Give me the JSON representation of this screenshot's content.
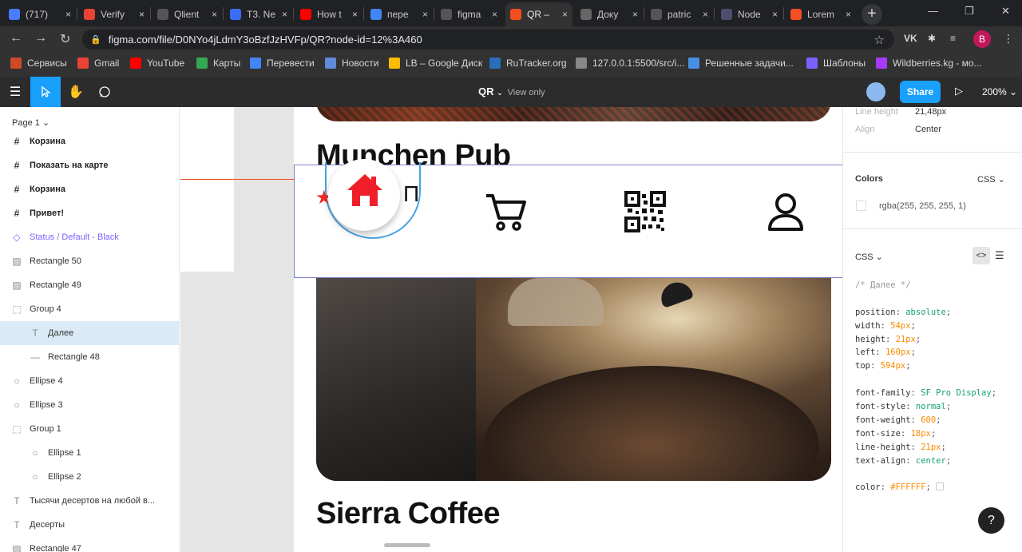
{
  "browser": {
    "tabs": [
      {
        "title": "(717)",
        "icon": "tab-favicon-pause",
        "color": "#4a7cff",
        "active": false
      },
      {
        "title": "Verify",
        "icon": "tab-favicon-gmail",
        "color": "#ea4335",
        "active": false
      },
      {
        "title": "Qlient",
        "icon": "tab-favicon-github",
        "color": "#555555",
        "active": false
      },
      {
        "title": "T3. Ne",
        "icon": "tab-favicon-doc",
        "color": "#3b6ef5",
        "active": false
      },
      {
        "title": "How t",
        "icon": "tab-favicon-youtube",
        "color": "#ff0000",
        "active": false
      },
      {
        "title": "пере",
        "icon": "tab-favicon-google",
        "color": "#4285f4",
        "active": false
      },
      {
        "title": "figma",
        "icon": "tab-favicon-github",
        "color": "#555555",
        "active": false
      },
      {
        "title": "QR –",
        "icon": "tab-favicon-figma",
        "color": "#f24e1e",
        "active": true
      },
      {
        "title": "Доку",
        "icon": "tab-favicon-globe",
        "color": "#666666",
        "active": false
      },
      {
        "title": "patric",
        "icon": "tab-favicon-github",
        "color": "#555555",
        "active": false
      },
      {
        "title": "Node",
        "icon": "tab-favicon-node",
        "color": "#4d4d6d",
        "active": false
      },
      {
        "title": "Lorem",
        "icon": "tab-favicon-ms",
        "color": "#f25022",
        "active": false
      }
    ],
    "tab_close": "×",
    "new_tab": "+",
    "window": {
      "minimize": "—",
      "maximize": "❐",
      "close": "✕"
    },
    "nav": {
      "back": "←",
      "forward": "→",
      "reload": "↻"
    },
    "url": "figma.com/file/D0NYo4jLdmY3oBzfJzHVFp/QR?node-id=12%3A460",
    "lock": "🔒",
    "star": "☆",
    "extensions": [
      "VK",
      "✱",
      "≡",
      "▮"
    ],
    "profile_initial": "В",
    "bookmarks": [
      {
        "label": "Сервисы",
        "icon": "apps-icon",
        "color": "#d04a2a"
      },
      {
        "label": "Gmail",
        "icon": "gmail-icon",
        "color": "#ea4335"
      },
      {
        "label": "YouTube",
        "icon": "youtube-icon",
        "color": "#ff0000"
      },
      {
        "label": "Карты",
        "icon": "maps-icon",
        "color": "#34a853"
      },
      {
        "label": "Перевести",
        "icon": "translate-icon",
        "color": "#4285f4"
      },
      {
        "label": "Новости",
        "icon": "news-icon",
        "color": "#5f8bd8"
      },
      {
        "label": "LB – Google Диск",
        "icon": "drive-icon",
        "color": "#fbbc04"
      },
      {
        "label": "RuTracker.org",
        "icon": "rutracker-icon",
        "color": "#2a6ebb"
      },
      {
        "label": "127.0.0.1:5500/src/i...",
        "icon": "globe-icon",
        "color": "#888888"
      },
      {
        "label": "Решенные задачи...",
        "icon": "task-icon",
        "color": "#4a90e2"
      },
      {
        "label": "Шаблоны",
        "icon": "templates-icon",
        "color": "#7b61ff"
      },
      {
        "label": "Wildberries.kg - мо...",
        "icon": "wildberries-icon",
        "color": "#a73afd"
      }
    ]
  },
  "figma": {
    "file_name": "QR",
    "view_mode": "View only",
    "share_label": "Share",
    "zoom": "200%",
    "page_label": "Page 1",
    "layers": [
      {
        "label": "Корзина",
        "type": "frame"
      },
      {
        "label": "Показать на карте",
        "type": "frame"
      },
      {
        "label": "Корзина",
        "type": "frame"
      },
      {
        "label": "Привет!",
        "type": "frame"
      },
      {
        "label": "Status / Default - Black",
        "type": "component"
      },
      {
        "label": "Rectangle 50",
        "type": "image"
      },
      {
        "label": "Rectangle 49",
        "type": "image"
      },
      {
        "label": "Group 4",
        "type": "group"
      },
      {
        "label": "Далее",
        "type": "text",
        "selected": true,
        "indent": 1
      },
      {
        "label": "Rectangle 48",
        "type": "line",
        "indent": 1
      },
      {
        "label": "Ellipse 4",
        "type": "ellipse"
      },
      {
        "label": "Ellipse 3",
        "type": "ellipse"
      },
      {
        "label": "Group 1",
        "type": "group"
      },
      {
        "label": "Ellipse 1",
        "type": "ellipse",
        "indent": 1
      },
      {
        "label": "Ellipse 2",
        "type": "ellipse",
        "indent": 1
      },
      {
        "label": "Тысячи десертов на любой в...",
        "type": "text"
      },
      {
        "label": "Десерты",
        "type": "text"
      },
      {
        "label": "Rectangle 47",
        "type": "image"
      }
    ]
  },
  "canvas": {
    "card1_title": "Munchen Pub",
    "card1_title_fragment": "П",
    "card2_title": "Sierra Coffee",
    "nav_icons": [
      "home-icon",
      "cart-icon",
      "qr-code-icon",
      "user-icon"
    ],
    "accent": "#ff1a1a"
  },
  "inspect": {
    "line_height_label": "Line height",
    "line_height_value": "21,48px",
    "align_label": "Align",
    "align_value": "Center",
    "colors_heading": "Colors",
    "colors_format": "CSS",
    "color_value": "rgba(255, 255, 255, 1)",
    "code_heading": "CSS",
    "code_lines": [
      {
        "kind": "comment",
        "text": "/* Далее */"
      },
      {
        "kind": "blank"
      },
      {
        "kind": "decl",
        "prop": "position",
        "val": "absolute",
        "vtype": "kw"
      },
      {
        "kind": "decl",
        "prop": "width",
        "val": "54px",
        "vtype": "num"
      },
      {
        "kind": "decl",
        "prop": "height",
        "val": "21px",
        "vtype": "num"
      },
      {
        "kind": "decl",
        "prop": "left",
        "val": "160px",
        "vtype": "num"
      },
      {
        "kind": "decl",
        "prop": "top",
        "val": "594px",
        "vtype": "num"
      },
      {
        "kind": "blank"
      },
      {
        "kind": "decl",
        "prop": "font-family",
        "val": "SF Pro Display",
        "vtype": "kw"
      },
      {
        "kind": "decl",
        "prop": "font-style",
        "val": "normal",
        "vtype": "kw"
      },
      {
        "kind": "decl",
        "prop": "font-weight",
        "val": "600",
        "vtype": "num"
      },
      {
        "kind": "decl",
        "prop": "font-size",
        "val": "18px",
        "vtype": "num"
      },
      {
        "kind": "decl",
        "prop": "line-height",
        "val": "21px",
        "vtype": "num"
      },
      {
        "kind": "decl",
        "prop": "text-align",
        "val": "center",
        "vtype": "kw"
      },
      {
        "kind": "blank"
      },
      {
        "kind": "decl",
        "prop": "color",
        "val": "#FFFFFF",
        "vtype": "num",
        "swatch": true
      }
    ],
    "help": "?"
  }
}
